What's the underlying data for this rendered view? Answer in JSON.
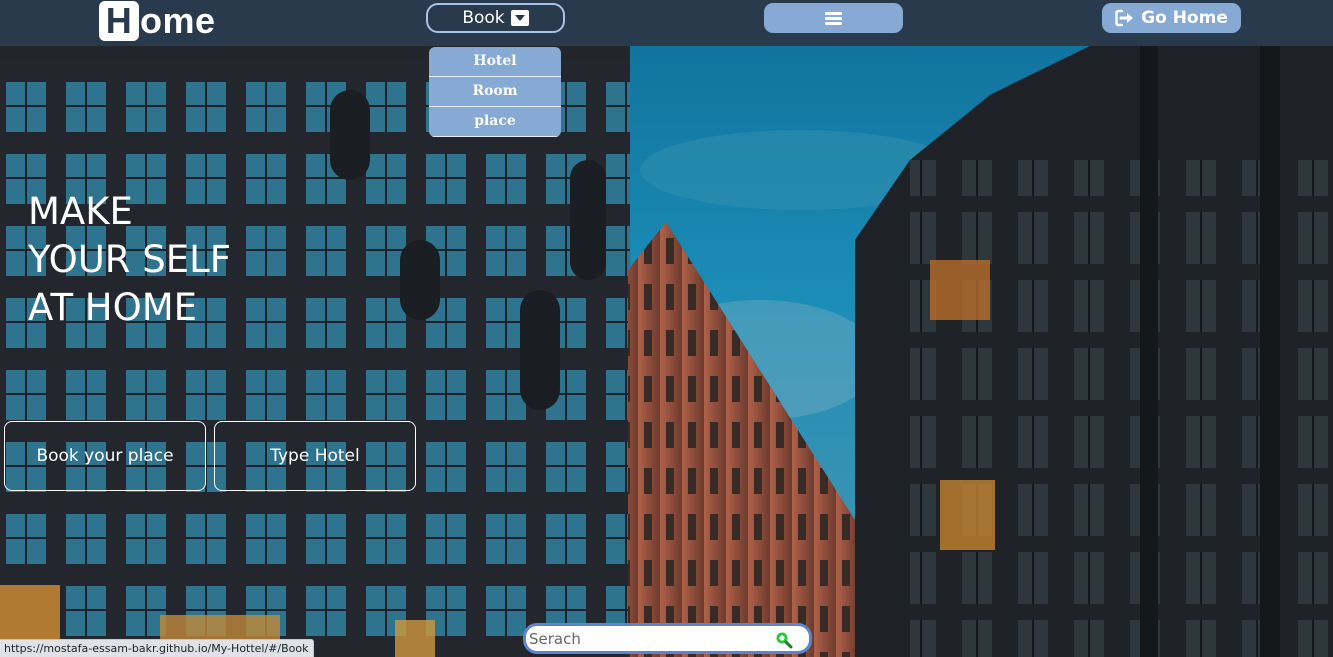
{
  "navbar": {
    "logo_initial": "H",
    "logo_rest": "ome",
    "book_label": "Book",
    "go_home_label": "Go Home"
  },
  "dropdown": {
    "items": [
      "Hotel",
      "Room",
      "place"
    ]
  },
  "hero": {
    "title_lines": [
      "MAKE",
      "YOUR SELF",
      "AT HOME"
    ],
    "book_place_label": "Book your place",
    "type_hotel_label": "Type Hotel"
  },
  "search": {
    "placeholder": "Serach"
  },
  "status_bar": {
    "url": "https://mostafa-essam-bakr.github.io/My-Hottel/#/Book"
  },
  "colors": {
    "navbar_bg": "#293a4c",
    "button_accent": "#86aad4",
    "search_border": "#5d84cf",
    "search_icon": "#22cc33"
  },
  "icons": {
    "book_caret": "caret-down-square-icon",
    "menu": "hamburger-icon",
    "go_home": "sign-out-arrow-icon",
    "search": "magnifier-icon"
  }
}
